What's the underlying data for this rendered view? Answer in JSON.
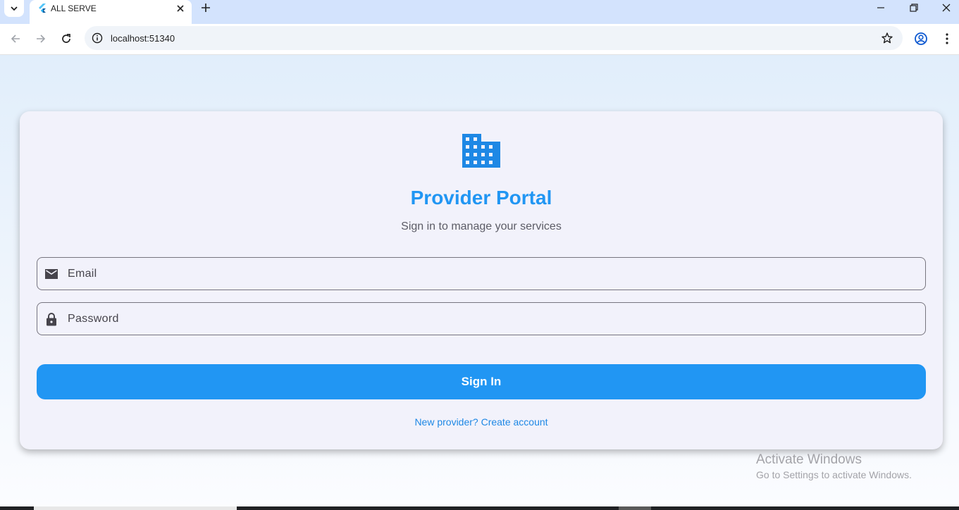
{
  "browser": {
    "tab_title": "ALL SERVE",
    "url": "localhost:51340"
  },
  "card": {
    "title": "Provider Portal",
    "subtitle": "Sign in to manage your services",
    "email_placeholder": "Email",
    "password_placeholder": "Password",
    "signin_label": "Sign In",
    "create_account_link": "New provider? Create account",
    "logo_icon": "building-icon"
  },
  "watermark": {
    "title": "Activate Windows",
    "subtitle": "Go to Settings to activate Windows."
  },
  "colors": {
    "accent": "#2196f3",
    "tabstrip": "#d3e3fd",
    "card_bg": "#f2f2fb"
  }
}
